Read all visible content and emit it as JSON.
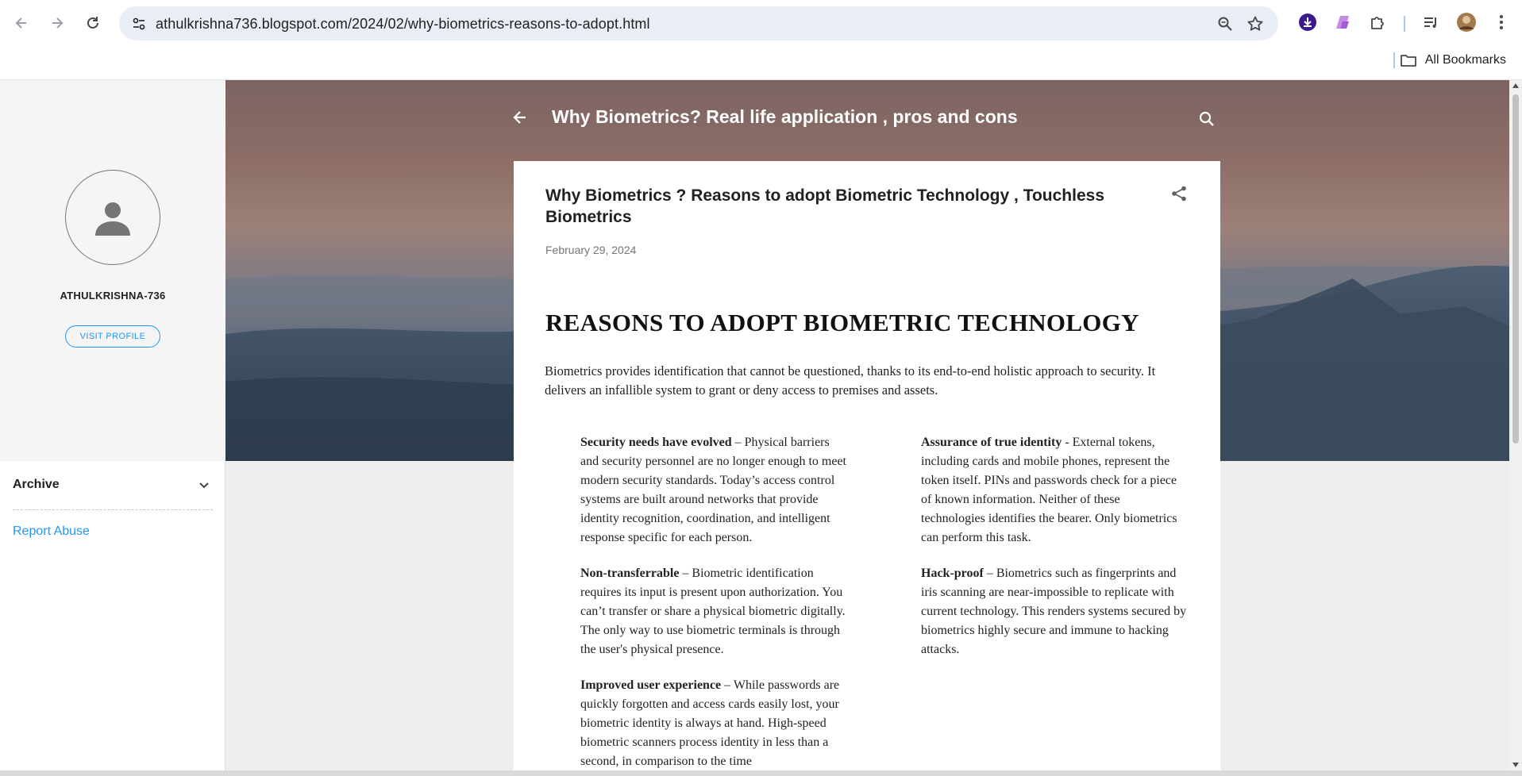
{
  "browser": {
    "url": "athulkrishna736.blogspot.com/2024/02/why-biometrics-reasons-to-adopt.html",
    "bookmarks_label": "All Bookmarks"
  },
  "sidebar": {
    "profile_name": "ATHULKRISHNA-736",
    "visit_profile": "VISIT PROFILE",
    "archive_label": "Archive",
    "report_abuse": "Report Abuse"
  },
  "header": {
    "title": "Why Biometrics? Real life application , pros and cons"
  },
  "post": {
    "title": "Why Biometrics ? Reasons to adopt Biometric Technology , Touchless Biometrics",
    "date": "February 29, 2024",
    "heading": "REASONS TO ADOPT BIOMETRIC TECHNOLOGY",
    "intro": "Biometrics provides identification that cannot be questioned, thanks to its end-to-end holistic approach to security. It delivers an infallible system to grant or deny access to premises and assets.",
    "left_column": [
      {
        "term": "Security needs have evolved",
        "text": " – Physical barriers and security personnel are no longer enough to meet modern security standards. Today’s access control systems are built around networks that provide identity recognition, coordination, and intelligent response specific for each person."
      },
      {
        "term": "Non-transferrable",
        "text": " – Biometric identification requires its input is present upon authorization. You can’t transfer or share a physical biometric digitally. The only way to use biometric terminals is through the user's physical presence."
      },
      {
        "term": "Improved user experience",
        "text": " – While passwords are quickly forgotten and access cards easily lost, your biometric identity is always at hand. High-speed biometric scanners process identity in less than a second, in comparison to the time"
      }
    ],
    "right_column": [
      {
        "term": "Assurance of true identity",
        "text": " - External tokens, including cards and mobile phones, represent the token itself. PINs and passwords check for a piece of known information. Neither of these technologies identifies the bearer. Only biometrics can perform this task."
      },
      {
        "term": "Hack-proof",
        "text": " – Biometrics such as fingerprints and iris scanning are near-impossible to replicate with current technology. This renders systems secured by biometrics highly secure and immune to hacking attacks."
      }
    ]
  },
  "colors": {
    "accent": "#2196f3",
    "omnibox": "#e9eef6",
    "text": "#212121"
  }
}
